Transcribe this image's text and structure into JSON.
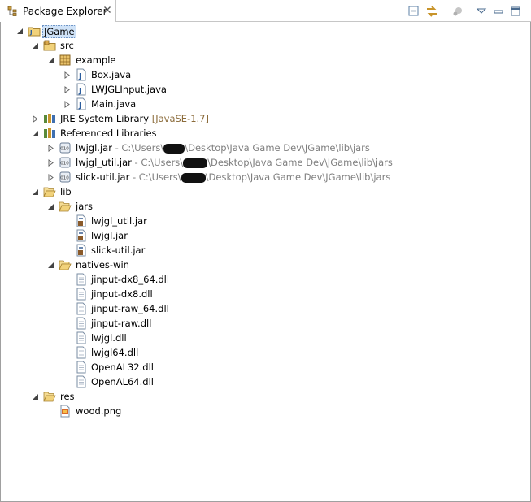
{
  "view": {
    "title": "Package Explorer",
    "toolbar": [
      "collapse-all-icon",
      "link-with-editor-icon",
      "focus-icon",
      "view-menu-icon",
      "minimize-icon",
      "maximize-icon"
    ]
  },
  "tree": [
    {
      "label": "JGame",
      "icon": "java-project-icon"
    },
    {
      "label": "src",
      "icon": "source-folder-icon"
    },
    {
      "label": "example",
      "icon": "package-icon"
    },
    {
      "label": "Box.java",
      "icon": "java-file-icon"
    },
    {
      "label": "LWJGLInput.java",
      "icon": "java-file-icon"
    },
    {
      "label": "Main.java",
      "icon": "java-file-icon"
    },
    {
      "label": "JRE System Library",
      "decoration": "[JavaSE-1.7]",
      "icon": "library-icon"
    },
    {
      "label": "Referenced Libraries",
      "icon": "library-icon"
    },
    {
      "label": "lwjgl.jar",
      "path_a": " - C:\\Users\\",
      "path_b": "\\Desktop\\Java Game Dev\\JGame\\lib\\jars",
      "icon": "jar-icon"
    },
    {
      "label": "lwjgl_util.jar",
      "path_a": " - C:\\Users\\",
      "path_b": "\\Desktop\\Java Game Dev\\JGame\\lib\\jars",
      "icon": "jar-icon"
    },
    {
      "label": "slick-util.jar",
      "path_a": " - C:\\Users\\",
      "path_b": "\\Desktop\\Java Game Dev\\JGame\\lib\\jars",
      "icon": "jar-icon"
    },
    {
      "label": "lib",
      "icon": "folder-icon"
    },
    {
      "label": "jars",
      "icon": "folder-icon"
    },
    {
      "label": "lwjgl_util.jar",
      "icon": "jar-file-icon"
    },
    {
      "label": "lwjgl.jar",
      "icon": "jar-file-icon"
    },
    {
      "label": "slick-util.jar",
      "icon": "jar-file-icon"
    },
    {
      "label": "natives-win",
      "icon": "folder-icon"
    },
    {
      "label": "jinput-dx8_64.dll",
      "icon": "file-icon"
    },
    {
      "label": "jinput-dx8.dll",
      "icon": "file-icon"
    },
    {
      "label": "jinput-raw_64.dll",
      "icon": "file-icon"
    },
    {
      "label": "jinput-raw.dll",
      "icon": "file-icon"
    },
    {
      "label": "lwjgl.dll",
      "icon": "file-icon"
    },
    {
      "label": "lwjgl64.dll",
      "icon": "file-icon"
    },
    {
      "label": "OpenAL32.dll",
      "icon": "file-icon"
    },
    {
      "label": "OpenAL64.dll",
      "icon": "file-icon"
    },
    {
      "label": "res",
      "icon": "folder-icon"
    },
    {
      "label": "wood.png",
      "icon": "image-file-icon"
    }
  ]
}
